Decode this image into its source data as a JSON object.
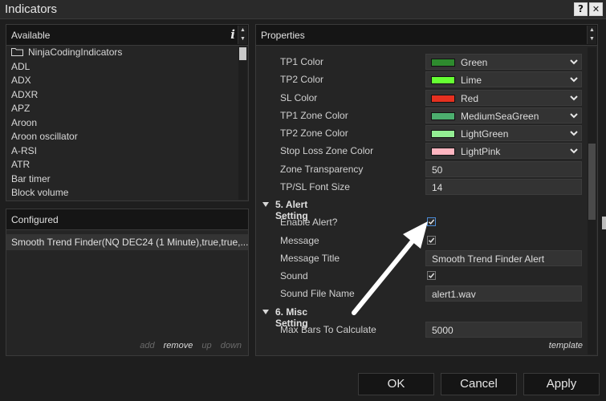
{
  "window": {
    "title": "Indicators",
    "help_glyph": "?",
    "close_glyph": "✕"
  },
  "available": {
    "header": "Available",
    "info_glyph": "i",
    "items": [
      {
        "label": "NinjaCodingIndicators",
        "type": "folder"
      },
      {
        "label": "ADL"
      },
      {
        "label": "ADX"
      },
      {
        "label": "ADXR"
      },
      {
        "label": "APZ"
      },
      {
        "label": "Aroon"
      },
      {
        "label": "Aroon oscillator"
      },
      {
        "label": "A-RSI"
      },
      {
        "label": "ATR"
      },
      {
        "label": "Bar timer"
      },
      {
        "label": "Block volume"
      }
    ]
  },
  "configured": {
    "header": "Configured",
    "items": [
      "Smooth Trend Finder(NQ DEC24 (1 Minute),true,true,..."
    ],
    "actions": {
      "add": "add",
      "remove": "remove",
      "up": "up",
      "down": "down"
    }
  },
  "properties": {
    "header": "Properties",
    "template_link": "template",
    "rows": [
      {
        "kind": "color",
        "label": "TP1 Color",
        "value": "Green",
        "color": "#2e8b2e"
      },
      {
        "kind": "color",
        "label": "TP2 Color",
        "value": "Lime",
        "color": "#66ff33"
      },
      {
        "kind": "color",
        "label": "SL Color",
        "value": "Red",
        "color": "#e53020"
      },
      {
        "kind": "color",
        "label": "TP1 Zone Color",
        "value": "MediumSeaGreen",
        "color": "#4cae6e"
      },
      {
        "kind": "color",
        "label": "TP2 Zone Color",
        "value": "LightGreen",
        "color": "#93ee93"
      },
      {
        "kind": "color",
        "label": "Stop Loss Zone Color",
        "value": "LightPink",
        "color": "#ffb6c1"
      },
      {
        "kind": "text",
        "label": "Zone Transparency",
        "value": "50"
      },
      {
        "kind": "text",
        "label": "TP/SL Font Size",
        "value": "14"
      },
      {
        "kind": "section",
        "label": "5. Alert Setting"
      },
      {
        "kind": "check",
        "label": "Enable Alert?",
        "checked": true,
        "focused": true
      },
      {
        "kind": "check",
        "label": "Message",
        "checked": true
      },
      {
        "kind": "text",
        "label": "Message Title",
        "value": "Smooth Trend Finder Alert"
      },
      {
        "kind": "check",
        "label": "Sound",
        "checked": true
      },
      {
        "kind": "text",
        "label": "Sound File Name",
        "value": "alert1.wav"
      },
      {
        "kind": "section",
        "label": "6. Misc Setting"
      },
      {
        "kind": "text",
        "label": "Max Bars To Calculate",
        "value": "5000"
      }
    ]
  },
  "buttons": {
    "ok": "OK",
    "cancel": "Cancel",
    "apply": "Apply"
  }
}
